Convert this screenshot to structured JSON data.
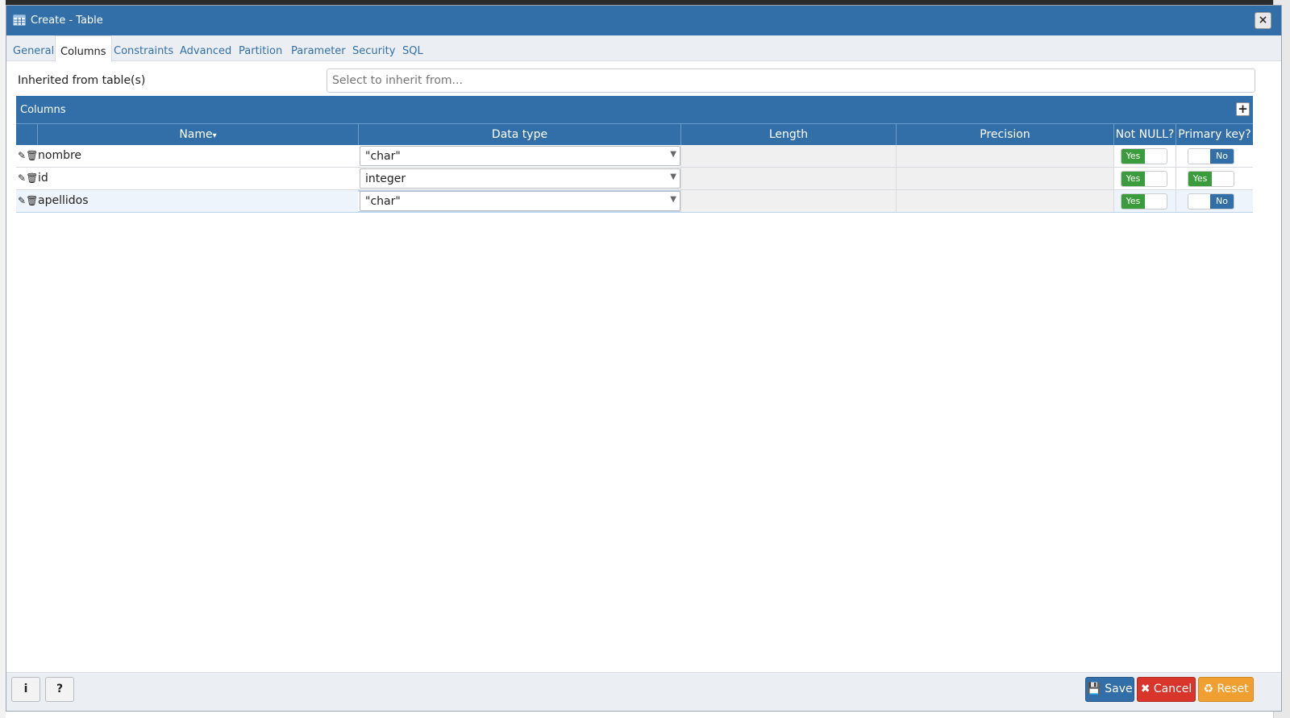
{
  "dialog": {
    "title": "Create - Table",
    "close_icon": "×"
  },
  "tabs": [
    {
      "label": "General"
    },
    {
      "label": "Columns",
      "active": true
    },
    {
      "label": "Constraints"
    },
    {
      "label": "Advanced"
    },
    {
      "label": "Partition"
    },
    {
      "label": "Parameter"
    },
    {
      "label": "Security"
    },
    {
      "label": "SQL"
    }
  ],
  "inherit": {
    "label": "Inherited from table(s)",
    "placeholder": "Select to inherit from..."
  },
  "columns_panel": {
    "title": "Columns",
    "add_label": "+",
    "headers": {
      "name": "Name",
      "sort_indicator": "▾",
      "data_type": "Data type",
      "length": "Length",
      "precision": "Precision",
      "not_null": "Not NULL?",
      "primary_key": "Primary key?"
    },
    "rows": [
      {
        "name": "nombre",
        "data_type": "\"char\"",
        "not_null": "Yes",
        "primary_key": "No"
      },
      {
        "name": "id",
        "data_type": "integer",
        "not_null": "Yes",
        "primary_key": "Yes"
      },
      {
        "name": "apellidos",
        "data_type": "\"char\"",
        "not_null": "Yes",
        "primary_key": "No"
      }
    ]
  },
  "footer": {
    "info_label": "i",
    "help_label": "?",
    "save_label": "Save",
    "cancel_label": "Cancel",
    "reset_label": "Reset"
  },
  "colors": {
    "primary": "#326fa8",
    "success": "#3b9c3b",
    "danger": "#d9352b",
    "warning": "#f0a030"
  }
}
